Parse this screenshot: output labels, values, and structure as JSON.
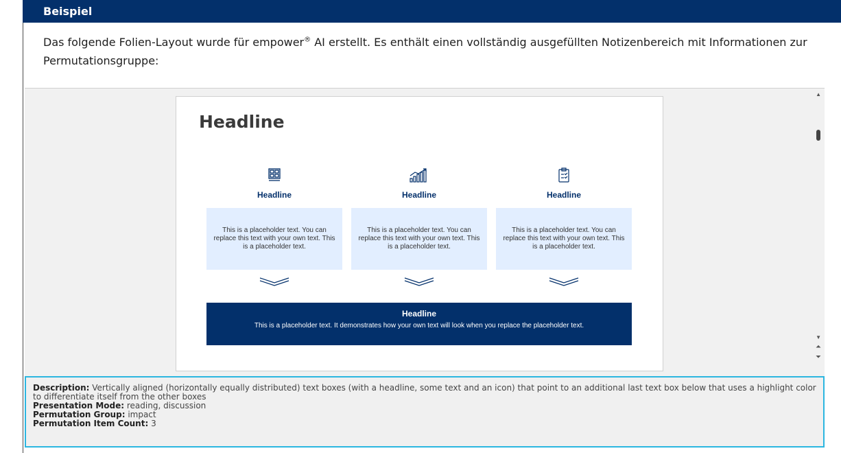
{
  "header": {
    "title": "Beispiel"
  },
  "intro": {
    "text_before_mark": "Das folgende Folien-Layout wurde für empower",
    "mark": "®",
    "text_after_mark": " AI erstellt. Es enthält einen vollständig ausgefüllten Notizenbereich mit Informationen zur Permutationsgruppe:"
  },
  "slide": {
    "title": "Headline",
    "columns": [
      {
        "icon": "grid-layout-icon",
        "headline": "Headline",
        "text": "This is a placeholder text. You can replace this text with your own text. This is a placeholder text."
      },
      {
        "icon": "growth-chart-icon",
        "headline": "Headline",
        "text": "This is a placeholder text. You can replace this text with your own text. This is a placeholder text."
      },
      {
        "icon": "clipboard-check-icon",
        "headline": "Headline",
        "text": "This is a placeholder text. You can replace this text with your own text. This is a placeholder text."
      }
    ],
    "highlight": {
      "headline": "Headline",
      "text": "This is a placeholder text. It demonstrates how your own text will look when you replace the placeholder text."
    }
  },
  "notes": {
    "description_label": "Description:",
    "description_value": " Vertically aligned (horizontally equally distributed) text boxes (with a headline, some text and an icon) that point to an additional last text box below that uses a highlight color to differentiate itself from the other boxes",
    "presentation_mode_label": "Presentation Mode:",
    "presentation_mode_value": " reading, discussion",
    "permutation_group_label": "Permutation Group:",
    "permutation_group_value": " impact",
    "permutation_count_label": "Permutation Item Count:",
    "permutation_count_value": " 3"
  },
  "scrollbar": {
    "up_icon": "scroll-up-arrow-icon",
    "down_icon": "scroll-down-arrow-icon",
    "prev_page_icon": "previous-page-icon",
    "next_page_icon": "next-page-icon"
  },
  "colors": {
    "banner": "#03306b",
    "text_box": "#e2eeff",
    "highlight_box": "#03306b",
    "notes_border": "#2bb6e0"
  }
}
